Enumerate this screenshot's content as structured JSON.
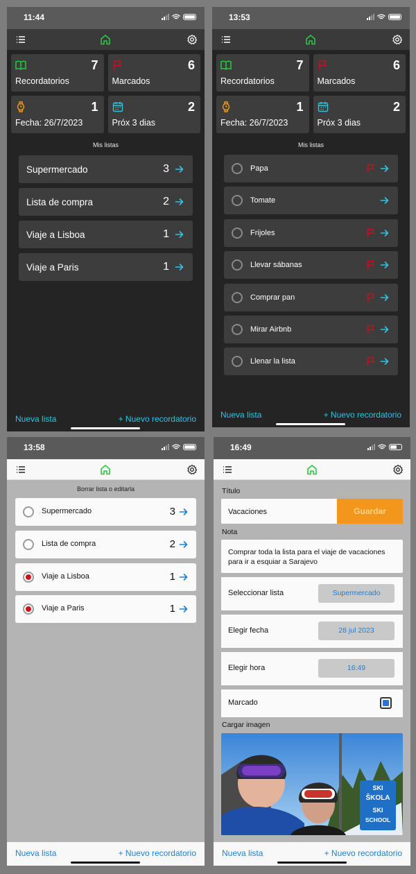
{
  "colors": {
    "accent_cyan": "#2ec4e6",
    "accent_blue": "#1b7fd6",
    "home_green": "#27c93f",
    "flag_red": "#c1121f",
    "calendar_orange": "#f39a1c",
    "save_orange": "#f3961c"
  },
  "screen1": {
    "time": "11:44",
    "cards": [
      {
        "icon": "book-icon",
        "count": "7",
        "label": "Recordatorios"
      },
      {
        "icon": "flag-icon",
        "count": "6",
        "label": "Marcados"
      },
      {
        "icon": "watch-icon",
        "count": "1",
        "label": "Fecha: 26/7/2023"
      },
      {
        "icon": "calendar-icon",
        "count": "2",
        "label": "Próx 3 dias"
      }
    ],
    "section_label": "Mis listas",
    "lists": [
      {
        "name": "Supermercado",
        "count": "3"
      },
      {
        "name": "Lista de compra",
        "count": "2"
      },
      {
        "name": "Viaje a Lisboa",
        "count": "1"
      },
      {
        "name": "Viaje a Paris",
        "count": "1"
      }
    ],
    "bottom": {
      "new_list": "Nueva lista",
      "new_reminder": "+ Nuevo recordatorio"
    }
  },
  "screen2": {
    "time": "13:53",
    "cards": [
      {
        "icon": "book-icon",
        "count": "7",
        "label": "Recordatorios"
      },
      {
        "icon": "flag-icon",
        "count": "6",
        "label": "Marcados"
      },
      {
        "icon": "watch-icon",
        "count": "1",
        "label": "Fecha: 26/7/2023"
      },
      {
        "icon": "calendar-icon",
        "count": "2",
        "label": "Próx 3 dias"
      }
    ],
    "section_label": "Mis listas",
    "items": [
      {
        "name": "Papa",
        "flagged": true
      },
      {
        "name": "Tomate",
        "flagged": false
      },
      {
        "name": "Frijoles",
        "flagged": true
      },
      {
        "name": "Llevar sábanas",
        "flagged": true
      },
      {
        "name": "Comprar pan",
        "flagged": true
      },
      {
        "name": "Mirar Airbnb",
        "flagged": true
      },
      {
        "name": "Llenar la lista",
        "flagged": true
      }
    ],
    "bottom": {
      "new_list": "Nueva lista",
      "new_reminder": "+ Nuevo recordatorio"
    }
  },
  "screen3": {
    "time": "13:58",
    "section_label": "Borrar lista o editarla",
    "lists": [
      {
        "name": "Supermercado",
        "count": "3",
        "selected": false
      },
      {
        "name": "Lista de compra",
        "count": "2",
        "selected": false
      },
      {
        "name": "Viaje a Lisboa",
        "count": "1",
        "selected": true
      },
      {
        "name": "Viaje a Paris",
        "count": "1",
        "selected": true
      }
    ],
    "bottom": {
      "new_list": "Nueva lista",
      "new_reminder": "+ Nuevo recordatorio"
    }
  },
  "screen4": {
    "time": "16:49",
    "title_label": "Título",
    "title_value": "Vacaciones",
    "save_button": "Guardar",
    "note_label": "Nota",
    "note_value": "Comprar toda la lista para el viaje de vacaciones para ir a esquiar a Sarajevo",
    "select_list_label": "Seleccionar lista",
    "select_list_value": "Supermercado",
    "date_label": "Elegir fecha",
    "date_value": "28 jul 2023",
    "time_label": "Elegir hora",
    "time_value": "16:49",
    "flagged_label": "Marcado",
    "flagged_checked": true,
    "image_label": "Cargar imagen",
    "image_sign_lines": [
      "SKI",
      "ŠKOLA",
      "SKI",
      "SCHOOL"
    ],
    "bottom": {
      "new_list": "Nueva lista",
      "new_reminder": "+ Nuevo recordatorio"
    }
  }
}
